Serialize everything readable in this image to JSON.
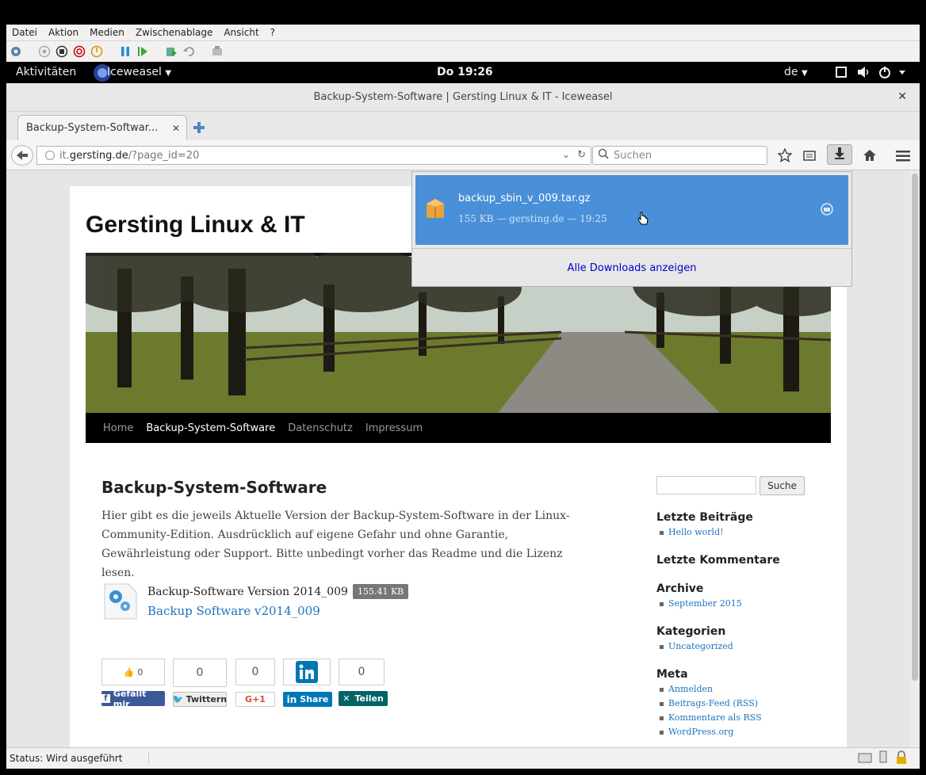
{
  "vm": {
    "menu": [
      "Datei",
      "Aktion",
      "Medien",
      "Zwischenablage",
      "Ansicht",
      "?"
    ],
    "status": "Status: Wird ausgeführt"
  },
  "gnome": {
    "activities": "Aktivitäten",
    "app": "Iceweasel",
    "clock": "Do 19:26",
    "lang": "de"
  },
  "browser": {
    "window_title": "Backup-System-Software | Gersting Linux & IT - Iceweasel",
    "tab_label": "Backup-System-Softwar...",
    "url_host_prefix": "it.",
    "url_host": "gersting.de",
    "url_path": "/?page_id=20",
    "search_placeholder": "Suchen"
  },
  "downloads": {
    "file": "backup_sbin_v_009.tar.gz",
    "meta": "155 KB — gersting.de — 19:25",
    "show_all": "Alle Downloads anzeigen"
  },
  "site": {
    "title": "Gersting Linux & IT",
    "nav": [
      "Home",
      "Backup-System-Software",
      "Datenschutz",
      "Impressum"
    ],
    "nav_current": 1,
    "entry_title": "Backup-System-Software",
    "entry_text": "Hier gibt es die jeweils Aktuelle Version der Backup-System-Software in der Linux-Community-Edition. Ausdrücklich auf eigene Gefahr und ohne Garantie, Gewährleistung oder Support. Bitte unbedingt vorher das Readme und die Lizenz lesen.",
    "download_title": "Backup-Software Version 2014_009",
    "download_size": "155.41 KB",
    "download_link": "Backup Software v2014_009",
    "social": {
      "fb_count": "0",
      "fb_label": "Gefällt mir",
      "tw_count": "0",
      "tw_label": "Twittern",
      "gp_count": "0",
      "gp_label": "G+1",
      "li_label": "Share",
      "xing_count": "0",
      "xing_label": "Teilen"
    },
    "sidebar": {
      "search_button": "Suche",
      "recent_posts_h": "Letzte Beiträge",
      "recent_posts": [
        "Hello world!"
      ],
      "recent_comments_h": "Letzte Kommentare",
      "archive_h": "Archive",
      "archive": [
        "September 2015"
      ],
      "categories_h": "Kategorien",
      "categories": [
        "Uncategorized"
      ],
      "meta_h": "Meta",
      "meta": [
        "Anmelden",
        "Beitrags-Feed (RSS)",
        "Kommentare als RSS",
        "WordPress.org"
      ]
    }
  },
  "colors": {
    "accent": "#4a90d9",
    "link": "#1e73be",
    "nav_bg": "#000000"
  }
}
